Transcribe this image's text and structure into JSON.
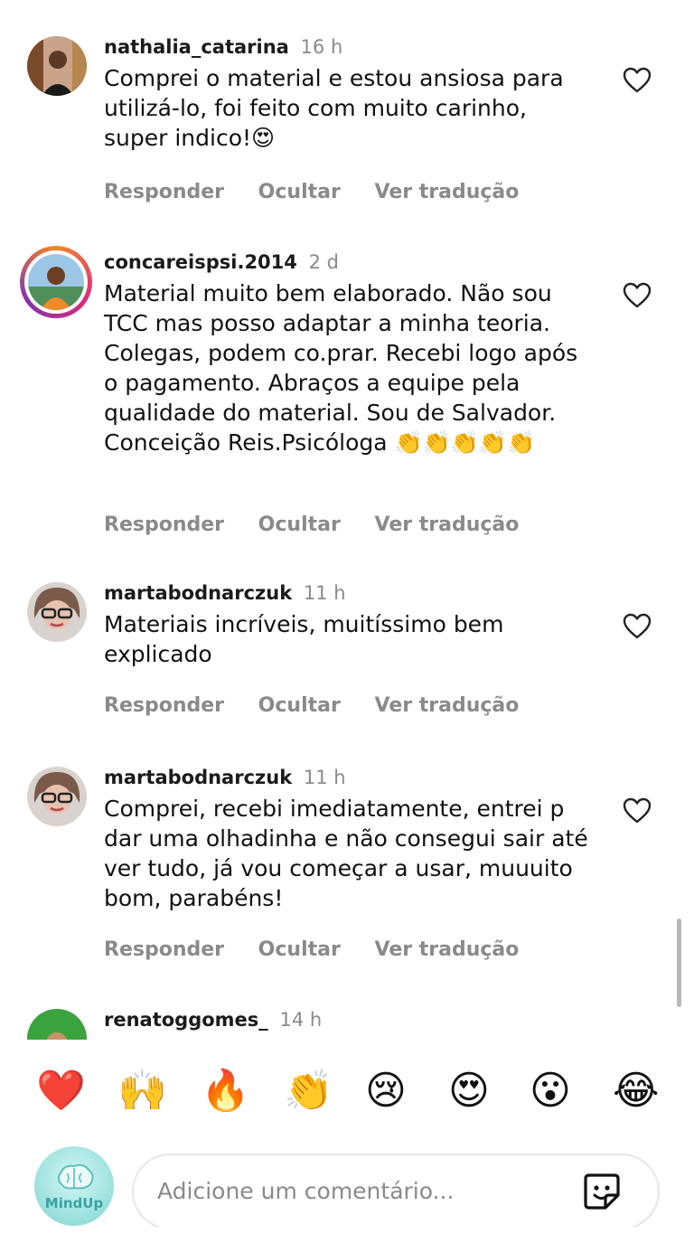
{
  "comments": [
    {
      "username": "nathalia_catarina",
      "time": "16 h",
      "text": "Comprei o material e estou ansiosa para utilizá-lo, foi feito com muito carinho, super indico!😍",
      "actions": [
        "Responder",
        "Ocultar",
        "Ver tradução"
      ]
    },
    {
      "username": "concareispsi.2014",
      "time": "2 d",
      "text": "Material muito bem elaborado. Não sou TCC mas posso adaptar a minha teoria. Colegas, podem co.prar. Recebi  logo após o pagamento. Abraços a equipe pela qualidade do material. Sou de Salvador. Conceição Reis.Psicóloga 👏👏👏👏👏",
      "actions": [
        "Responder",
        "Ocultar",
        "Ver tradução"
      ]
    },
    {
      "username": "martabodnarczuk",
      "time": "11 h",
      "text": "Materiais incríveis, muitíssimo bem explicado",
      "actions": [
        "Responder",
        "Ocultar",
        "Ver tradução"
      ]
    },
    {
      "username": "martabodnarczuk",
      "time": "11 h",
      "text": "Comprei, recebi imediatamente, entrei p dar uma olhadinha e não consegui sair até ver tudo, já vou começar a usar, muuuito bom, parabéns!",
      "actions": [
        "Responder",
        "Ocultar",
        "Ver tradução"
      ]
    },
    {
      "username": "renatoggomes_",
      "time": "14 h",
      "text": "",
      "actions": []
    }
  ],
  "reactions": [
    "❤️",
    "🙌",
    "🔥",
    "👏",
    "😢",
    "😍",
    "😮",
    "😂"
  ],
  "composer": {
    "placeholder": "Adicione um comentário...",
    "avatar_brand": "MindUp"
  },
  "colors": {
    "muted_text": "#8a8a8a",
    "story_ring": [
      "#f58529",
      "#dd2a7b",
      "#8134af"
    ],
    "brand_teal": "#7dd3cf"
  },
  "icons": [
    "heart-outline-icon",
    "sticker-icon"
  ]
}
